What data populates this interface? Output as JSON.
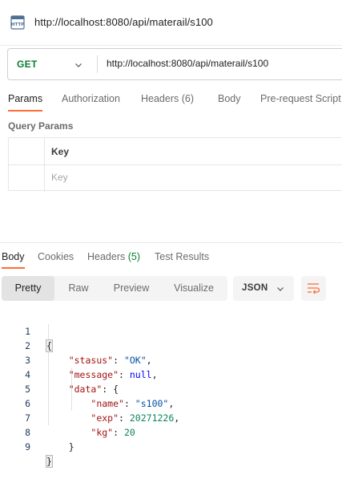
{
  "request": {
    "title": "http://localhost:8080/api/materail/s100",
    "icon": "http-file-icon",
    "method": "GET",
    "url": "http://localhost:8080/api/materail/s100"
  },
  "request_tabs": [
    {
      "label": "Params",
      "active": true
    },
    {
      "label": "Authorization",
      "active": false
    },
    {
      "label": "Headers (6)",
      "active": false
    },
    {
      "label": "Body",
      "active": false
    },
    {
      "label": "Pre-request Script",
      "active": false
    }
  ],
  "query_params": {
    "section_label": "Query Params",
    "key_header": "Key",
    "key_placeholder": "Key"
  },
  "response_tabs": {
    "body": "Body",
    "cookies": "Cookies",
    "headers": "Headers",
    "headers_count": "(5)",
    "test_results": "Test Results"
  },
  "format": {
    "options": [
      "Pretty",
      "Raw",
      "Preview",
      "Visualize"
    ],
    "selected": "Pretty",
    "language": "JSON"
  },
  "code": {
    "line_numbers": [
      "1",
      "2",
      "3",
      "4",
      "5",
      "6",
      "7",
      "8",
      "9"
    ],
    "open_brace": "{",
    "close_brace": "}",
    "status_key": "\"stasus\"",
    "status_value": "\"OK\"",
    "message_key": "\"message\"",
    "message_value": "null",
    "data_key": "\"data\"",
    "name_key": "\"name\"",
    "name_value": "\"s100\"",
    "exp_key": "\"exp\"",
    "exp_value": "20271226",
    "kg_key": "\"kg\"",
    "kg_value": "20"
  },
  "colors": {
    "accent": "#ff6c37",
    "method_get": "#0a7d33",
    "json_key": "#a31515",
    "json_string": "#0451a5",
    "json_number": "#098658",
    "json_null": "#0000ff"
  }
}
